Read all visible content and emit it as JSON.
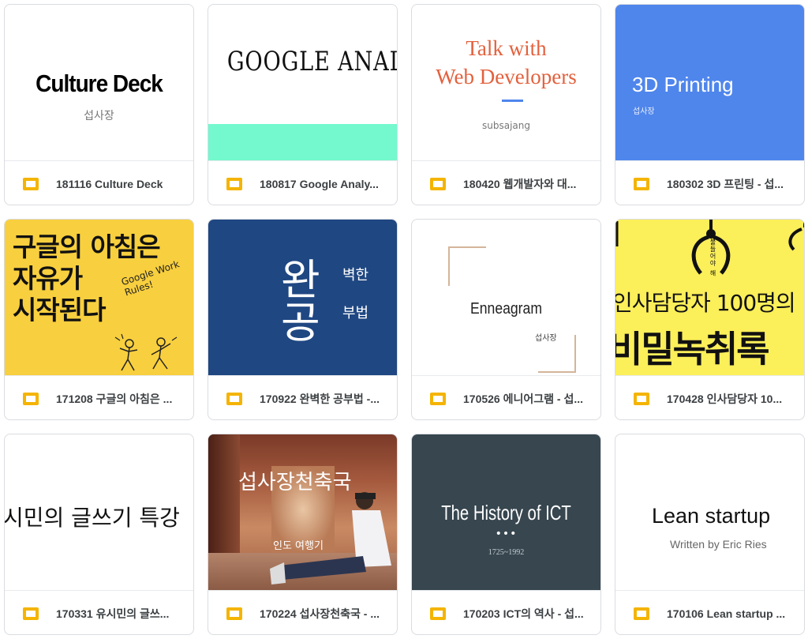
{
  "files": [
    {
      "title": "181116 Culture Deck",
      "thumb": {
        "heading": "Culture Deck",
        "subtitle": "섭사장"
      }
    },
    {
      "title": "180817 Google Analy...",
      "thumb": {
        "heading": "GOOGLE ANALYTICS"
      }
    },
    {
      "title": "180420 웹개발자와 대...",
      "thumb": {
        "line1": "Talk with",
        "line2": "Web Developers",
        "subtitle": "subsajang"
      }
    },
    {
      "title": "180302 3D 프린팅 - 섭...",
      "thumb": {
        "heading": "3D Printing",
        "subtitle": "섭사장"
      }
    },
    {
      "title": "171208 구글의 아침은 ...",
      "thumb": {
        "line1": "구글의 아침은",
        "line2": "자유가",
        "line3": "시작된다",
        "tag": "Google Work Rules!"
      }
    },
    {
      "title": "170922 완벽한 공부법 -...",
      "thumb": {
        "big1": "완",
        "big2": "공",
        "small1": "벽한",
        "small2": "부법"
      }
    },
    {
      "title": "170526 에니어그램 - 섭...",
      "thumb": {
        "heading": "Enneagram",
        "subtitle": "섭사장"
      }
    },
    {
      "title": "170428 인사담당자 10...",
      "thumb": {
        "line1": "인사담당자 100명의",
        "line2": "비밀녹취록",
        "vertical": "불들어야 해"
      }
    },
    {
      "title": "170331 유시민의 글쓰...",
      "thumb": {
        "heading": "시민의 글쓰기 특강"
      }
    },
    {
      "title": "170224 섭사장천축국 - ...",
      "thumb": {
        "heading": "섭사장천축국",
        "subtitle": "인도 여행기"
      }
    },
    {
      "title": "170203 ICT의 역사 - 섭...",
      "thumb": {
        "heading": "The History of ICT",
        "dots": "•••",
        "subtitle": "1725~1992"
      }
    },
    {
      "title": "170106 Lean startup ...",
      "thumb": {
        "heading": "Lean startup",
        "subtitle": "Written by Eric Ries"
      }
    }
  ],
  "colors": {
    "accent_blue": "#4f86ec",
    "mint": "#73f9cd",
    "yellow": "#f8cf3e",
    "navy": "#1f4782",
    "slate": "#37464f",
    "orange_red": "#e3613d",
    "bright_yellow": "#fbef5a"
  }
}
